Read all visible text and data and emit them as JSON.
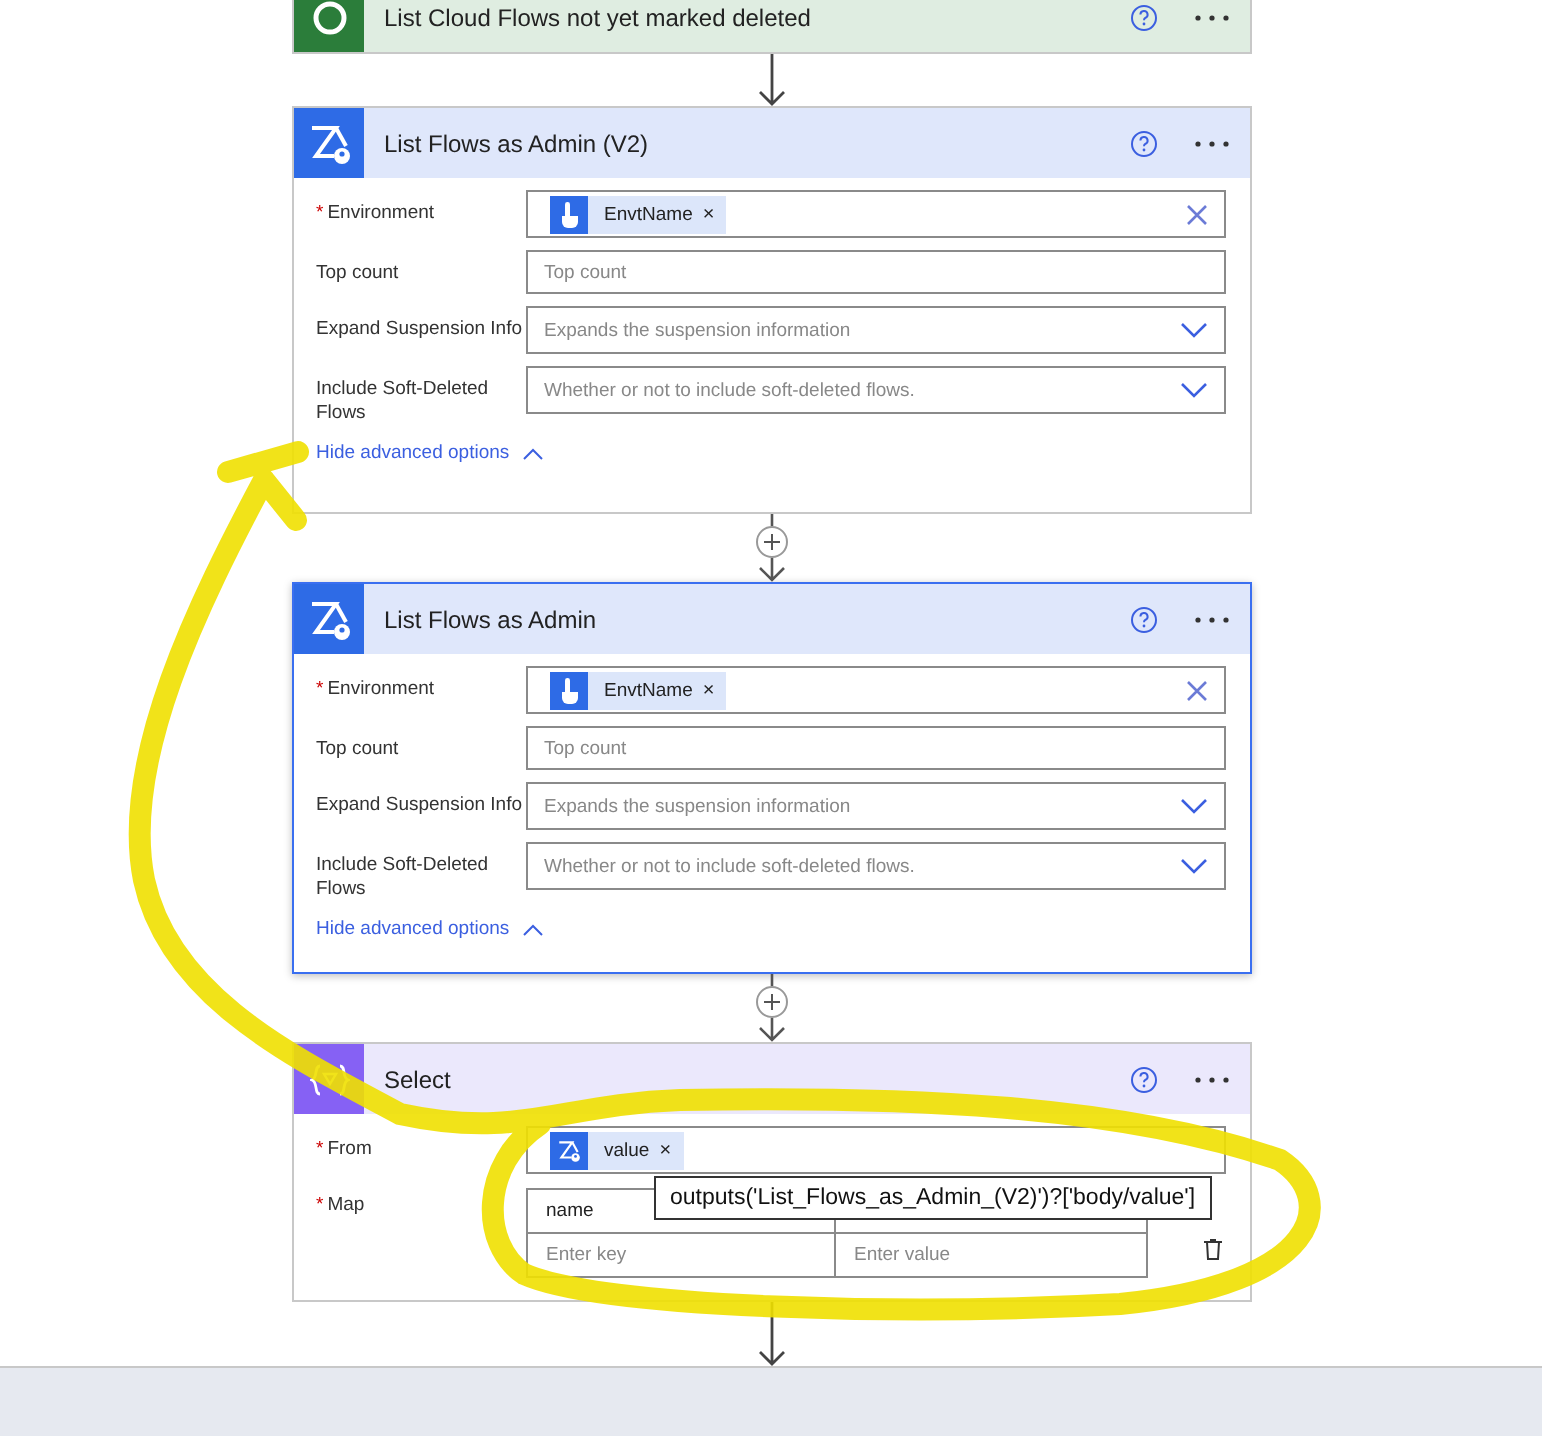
{
  "previous_step": {
    "title": "List Cloud Flows not yet marked deleted"
  },
  "steps": [
    {
      "kind": "admin",
      "title": "List Flows as Admin (V2)",
      "selected": false,
      "fields": [
        {
          "kind": "token",
          "label": "Environment",
          "required_mark": "*",
          "token": "EnvtName",
          "remove": "×"
        },
        {
          "kind": "text",
          "label": "Top count",
          "placeholder": "Top count"
        },
        {
          "kind": "dropdown",
          "label": "Expand Suspension Info",
          "placeholder": "Expands the suspension information"
        },
        {
          "kind": "dropdown",
          "label": "Include Soft-Deleted Flows",
          "placeholder": "Whether or not to include soft-deleted flows."
        }
      ],
      "advanced_link": "Hide advanced options"
    },
    {
      "kind": "admin",
      "title": "List Flows as Admin",
      "selected": true,
      "fields": [
        {
          "kind": "token",
          "label": "Environment",
          "required_mark": "*",
          "token": "EnvtName",
          "remove": "×"
        },
        {
          "kind": "text",
          "label": "Top count",
          "placeholder": "Top count"
        },
        {
          "kind": "dropdown",
          "label": "Expand Suspension Info",
          "placeholder": "Expands the suspension information"
        },
        {
          "kind": "dropdown",
          "label": "Include Soft-Deleted Flows",
          "placeholder": "Whether or not to include soft-deleted flows."
        }
      ],
      "advanced_link": "Hide advanced options"
    },
    {
      "kind": "select",
      "title": "Select",
      "selected": false,
      "fields": [
        {
          "kind": "flow_token",
          "label": "From",
          "required_mark": "*",
          "token": "value",
          "remove": "×"
        },
        {
          "kind": "map",
          "label": "Map",
          "required_mark": "*",
          "rows": [
            {
              "key": "name"
            },
            {
              "key_placeholder": "Enter key",
              "value_placeholder": "Enter value"
            }
          ]
        }
      ]
    }
  ],
  "tooltip": "outputs('List_Flows_as_Admin_(V2)')?['body/value']"
}
